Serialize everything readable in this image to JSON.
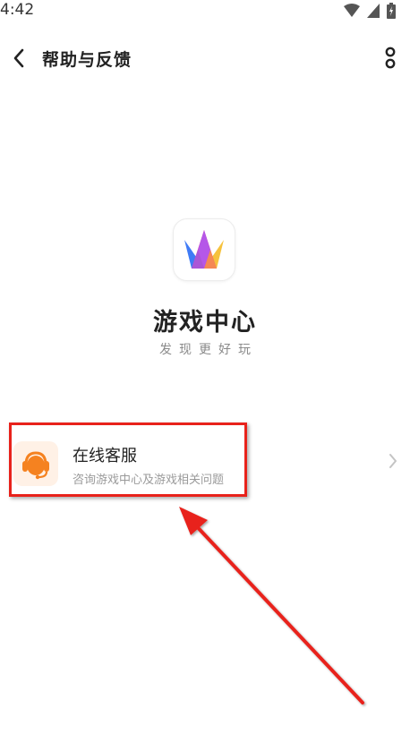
{
  "status_bar": {
    "time": "4:42"
  },
  "app_bar": {
    "title": "帮助与反馈"
  },
  "app_info": {
    "name": "游戏中心",
    "slogan": "发现更好玩"
  },
  "service": {
    "title": "在线客服",
    "subtitle": "咨询游戏中心及游戏相关问题"
  },
  "colors": {
    "accent_orange": "#f58220",
    "highlight_red": "#e8221b"
  },
  "icons": [
    "wifi-icon",
    "signal-icon",
    "battery-icon",
    "back-arrow-icon",
    "more-icon",
    "app-logo-icon",
    "headset-icon",
    "chevron-right-icon"
  ]
}
